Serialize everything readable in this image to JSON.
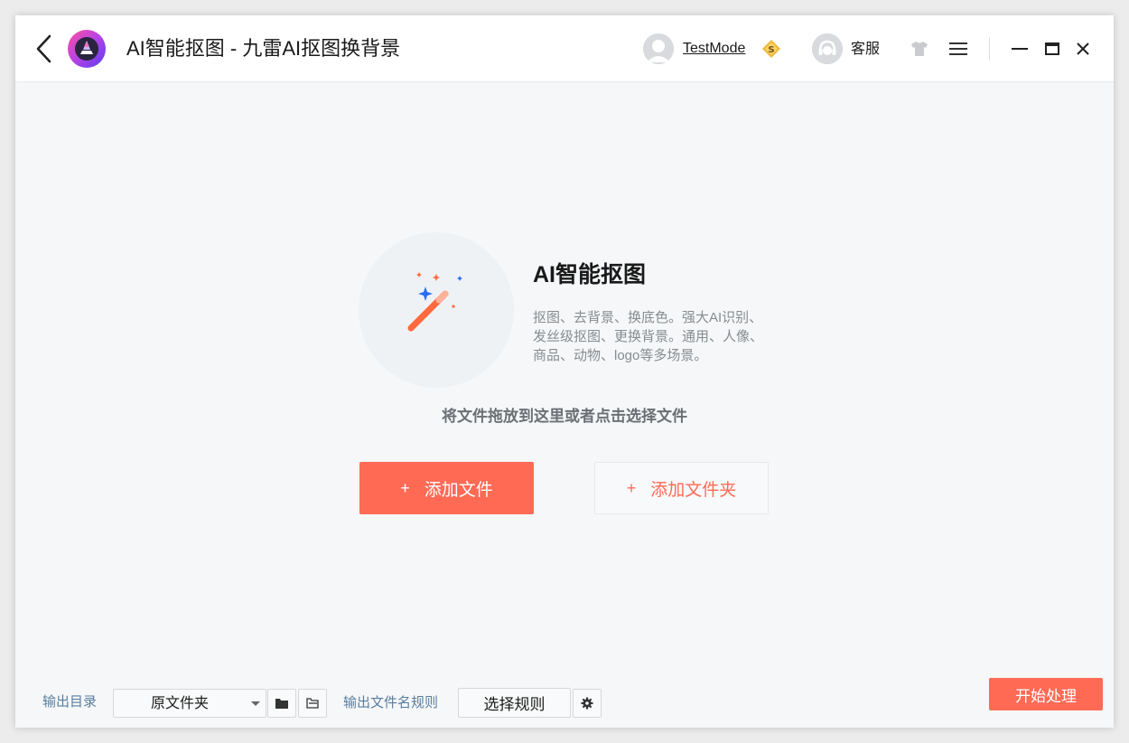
{
  "header": {
    "title": "AI智能抠图 - 九雷AI抠图换背景",
    "user_name": "TestMode",
    "support_label": "客服"
  },
  "main": {
    "feature_title": "AI智能抠图",
    "feature_desc": "抠图、去背景、换底色。强大AI识别、发丝级抠图、更换背景。通用、人像、商品、动物、logo等多场景。",
    "drop_hint": "将文件拖放到这里或者点击选择文件",
    "add_file_label": "添加文件",
    "add_folder_label": "添加文件夹",
    "plus_symbol": "+"
  },
  "footer": {
    "output_dir_label": "输出目录",
    "output_dir_value": "原文件夹",
    "name_rule_label": "输出文件名规则",
    "select_rule_label": "选择规则",
    "start_label": "开始处理"
  },
  "colors": {
    "accent": "#ff6a55",
    "label_blue": "#5a7ea0",
    "background": "#f5f7f8"
  },
  "icons": {
    "back": "chevron-left-icon",
    "logo": "app-logo-icon",
    "vip": "vip-coin-icon",
    "skin": "tshirt-icon",
    "menu": "hamburger-menu-icon",
    "minimize": "minimize-icon",
    "maximize": "maximize-icon",
    "close": "close-icon",
    "wand": "magic-wand-icon",
    "folder": "folder-icon",
    "open_folder": "folder-open-icon",
    "settings": "gear-icon"
  }
}
